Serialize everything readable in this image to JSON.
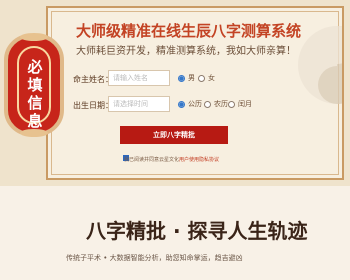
{
  "page": {
    "title": "大师级精准在线生辰八字测算系统",
    "subtitle": "大师耗巨资开发，精准测算系统，我如大师亲算！",
    "ribbon_text": "必填信息"
  },
  "form": {
    "name_label": "命主姓名：",
    "name_placeholder": "请输入姓名",
    "gender_options": [
      "男",
      "女"
    ],
    "birth_label": "出生日期：",
    "birth_placeholder": "请选择时间",
    "calendar_options": [
      "公历",
      "农历",
      "闰月"
    ],
    "submit_label": "立即八字精批",
    "agree_text": "我已阅读并同意云星文化",
    "agree_link": "用户使用隐私协议"
  },
  "section": {
    "title": "八字精批 · 探寻人生轨迹",
    "subtitle": "传统子平术 • 大数据智能分析，助您知命掌运，趋吉避凶"
  }
}
